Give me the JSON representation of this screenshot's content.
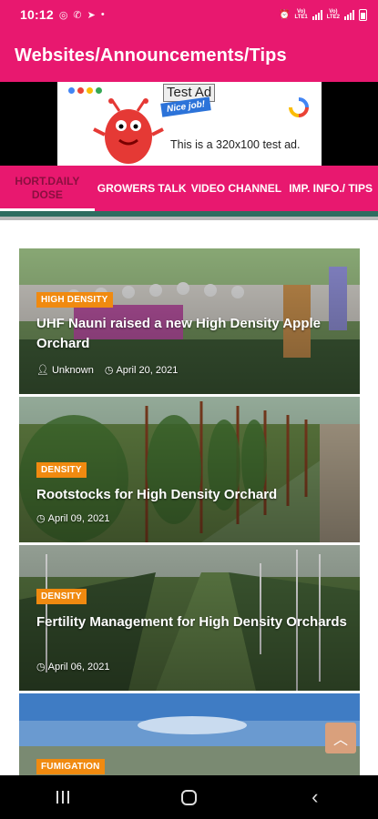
{
  "status_bar": {
    "time": "10:12",
    "icons_left": [
      "instagram-icon",
      "whatsapp-icon",
      "telegram-icon",
      "dot-icon"
    ],
    "icons_right": [
      "alarm-icon",
      "volte-icon",
      "lte-signal-icon",
      "volte-icon",
      "lte-signal-icon",
      "battery-icon"
    ],
    "lte1": "Vo)) LTE1",
    "lte2": "Vo)) LTE2"
  },
  "app_bar": {
    "title": "Websites/Announcements/Tips"
  },
  "ad": {
    "label": "Test Ad",
    "nice": "Nice job!",
    "text": "This is a 320x100 test ad."
  },
  "tabs": [
    {
      "label": "HORT.DAILY DOSE",
      "active": true
    },
    {
      "label": "GROWERS TALK",
      "active": false
    },
    {
      "label": "VIDEO CHANNEL",
      "active": false
    },
    {
      "label": "IMP. INFO./ TIPS",
      "active": false
    }
  ],
  "posts": [
    {
      "badge": "HIGH DENSITY",
      "title": "UHF Nauni raised a new High Density Apple Orchard",
      "author": "Unknown",
      "date": "April 20, 2021"
    },
    {
      "badge": "DENSITY",
      "title": "Rootstocks for High Density Orchard",
      "author": "",
      "date": "April 09, 2021"
    },
    {
      "badge": "DENSITY",
      "title": "Fertility Management for High Density Orchards",
      "author": "",
      "date": "April 06, 2021"
    },
    {
      "badge": "FUMIGATION",
      "title": "",
      "author": "",
      "date": ""
    }
  ],
  "colors": {
    "primary": "#e8186f",
    "active_tab_text": "#8a0f3f",
    "badge": "#f08a10",
    "scroll_top": "#d9a07c"
  }
}
